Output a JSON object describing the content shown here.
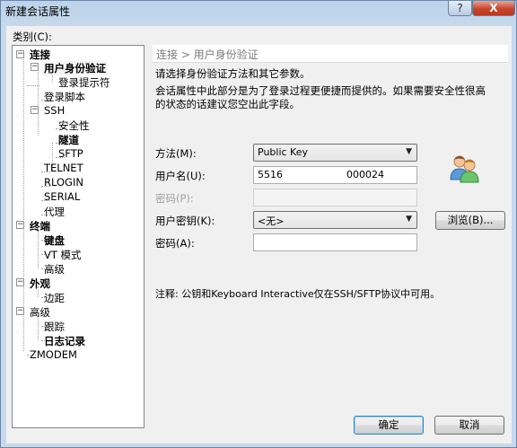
{
  "window": {
    "title": "新建会话属性",
    "help_label": "?",
    "close_label": "X"
  },
  "category_label": "类别(C):",
  "tree": {
    "items": [
      {
        "label": "连接"
      },
      {
        "label": "用户身份验证"
      },
      {
        "label": "登录提示符"
      },
      {
        "label": "登录脚本"
      },
      {
        "label": "SSH"
      },
      {
        "label": "安全性"
      },
      {
        "label": "隧道"
      },
      {
        "label": "SFTP"
      },
      {
        "label": "TELNET"
      },
      {
        "label": "RLOGIN"
      },
      {
        "label": "SERIAL"
      },
      {
        "label": "代理"
      },
      {
        "label": "终端"
      },
      {
        "label": "键盘"
      },
      {
        "label": "VT 模式"
      },
      {
        "label": "高级"
      },
      {
        "label": "外观"
      },
      {
        "label": "边距"
      },
      {
        "label": "高级"
      },
      {
        "label": "跟踪"
      },
      {
        "label": "日志记录"
      },
      {
        "label": "ZMODEM"
      }
    ],
    "toggle_minus": "−"
  },
  "panel": {
    "breadcrumb": "连接 > 用户身份验证",
    "desc1": "请选择身份验证方法和其它参数。",
    "desc2_line1": "会话属性中此部分是为了登录过程更便捷而提供的。如果需要安全性很高",
    "desc2_line2": "的状态的话建议您空出此字段。",
    "method_label": "方法(M):",
    "method_value": "Public Key",
    "username_label": "用户名(U):",
    "username_value_start": "5516",
    "username_value_end": "000024",
    "password_p_label": "密码(P):",
    "user_key_label": "用户密钥(K):",
    "user_key_value": "<无>",
    "browse_label": "浏览(B)...",
    "passphrase_label": "密码(A):",
    "note": "注释: 公钥和Keyboard Interactive仅在SSH/SFTP协议中可用。"
  },
  "buttons": {
    "ok": "确定",
    "cancel": "取消"
  }
}
